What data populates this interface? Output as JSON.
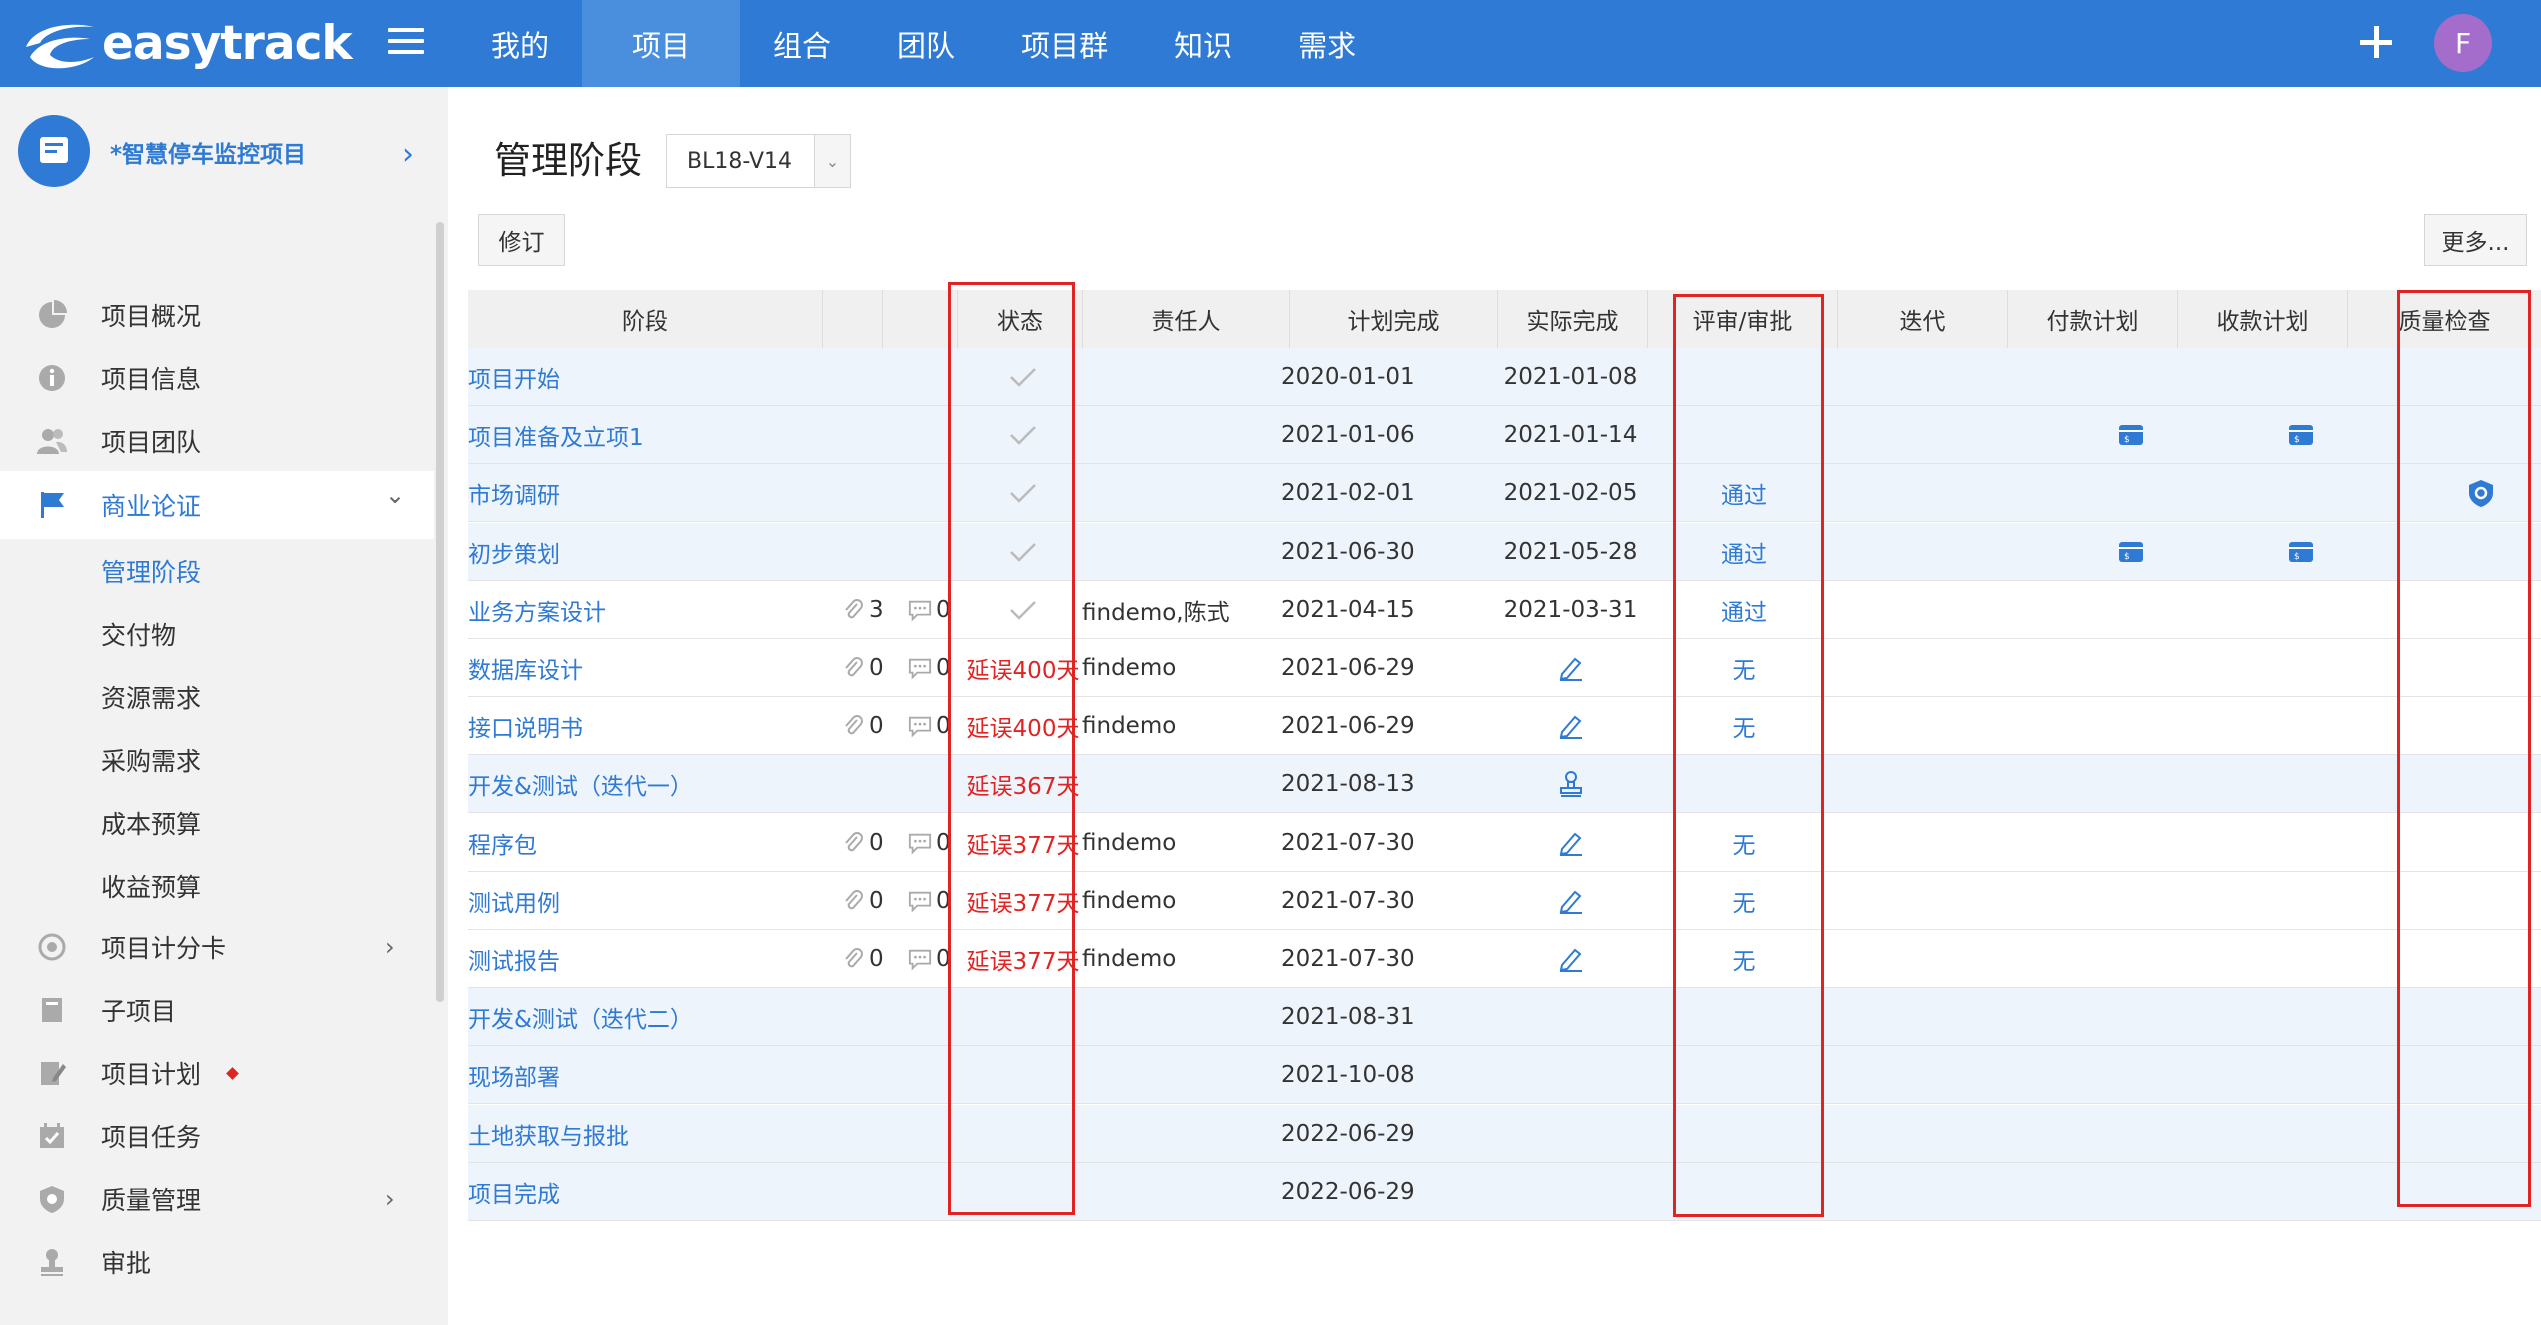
{
  "app": {
    "logo_text": "easytrack"
  },
  "nav": {
    "items": [
      {
        "label": "我的",
        "active": false
      },
      {
        "label": "项目",
        "active": true
      },
      {
        "label": "组合",
        "active": false
      },
      {
        "label": "团队",
        "active": false
      },
      {
        "label": "项目群",
        "active": false
      },
      {
        "label": "知识",
        "active": false
      },
      {
        "label": "需求",
        "active": false
      }
    ],
    "avatar_letter": "F"
  },
  "sidebar": {
    "project_name": "*智慧停车监控项目",
    "items": [
      {
        "label": "项目概况",
        "icon": "pie-chart-icon"
      },
      {
        "label": "项目信息",
        "icon": "info-icon"
      },
      {
        "label": "项目团队",
        "icon": "team-icon"
      },
      {
        "label": "商业论证",
        "icon": "flag-icon",
        "expanded": true
      },
      {
        "label": "管理阶段",
        "sub": true,
        "active": true
      },
      {
        "label": "交付物",
        "sub": true
      },
      {
        "label": "资源需求",
        "sub": true
      },
      {
        "label": "采购需求",
        "sub": true
      },
      {
        "label": "成本预算",
        "sub": true
      },
      {
        "label": "收益预算",
        "sub": true
      },
      {
        "label": "项目计分卡",
        "icon": "target-icon",
        "chevron": true
      },
      {
        "label": "子项目",
        "icon": "book-icon"
      },
      {
        "label": "项目计划",
        "icon": "edit-doc-icon",
        "badge": true
      },
      {
        "label": "项目任务",
        "icon": "calendar-check-icon"
      },
      {
        "label": "质量管理",
        "icon": "shield-icon",
        "chevron": true
      },
      {
        "label": "审批",
        "icon": "stamp-icon"
      }
    ]
  },
  "page": {
    "title": "管理阶段",
    "version": "BL18-V14",
    "revise_label": "修订",
    "more_label": "更多..."
  },
  "table": {
    "headers": {
      "stage": "阶段",
      "status": "状态",
      "owner": "责任人",
      "plan_done": "计划完成",
      "actual_done": "实际完成",
      "review": "评审/审批",
      "iteration": "迭代",
      "payment": "付款计划",
      "receipt": "收款计划",
      "quality": "质量检查"
    },
    "rows": [
      {
        "stage": "项目开始",
        "attach": "",
        "comment": "",
        "status": "done",
        "owner": "",
        "plan": "2020-01-01",
        "actual": "2021-01-08",
        "review": "",
        "pay": false,
        "recv": false,
        "qc": false,
        "shade": true
      },
      {
        "stage": "项目准备及立项1",
        "attach": "",
        "comment": "",
        "status": "done",
        "owner": "",
        "plan": "2021-01-06",
        "actual": "2021-01-14",
        "review": "",
        "pay": true,
        "recv": true,
        "qc": false,
        "shade": true
      },
      {
        "stage": "市场调研",
        "attach": "",
        "comment": "",
        "status": "done",
        "owner": "",
        "plan": "2021-02-01",
        "actual": "2021-02-05",
        "review": "通过",
        "pay": false,
        "recv": false,
        "qc": true,
        "shade": true
      },
      {
        "stage": "初步策划",
        "attach": "",
        "comment": "",
        "status": "done",
        "owner": "",
        "plan": "2021-06-30",
        "actual": "2021-05-28",
        "review": "通过",
        "pay": true,
        "recv": true,
        "qc": false,
        "shade": true
      },
      {
        "stage": "业务方案设计",
        "attach": "3",
        "comment": "0",
        "status": "done",
        "owner": "findemo,陈式",
        "plan": "2021-04-15",
        "actual": "2021-03-31",
        "review": "通过",
        "pay": false,
        "recv": false,
        "qc": false,
        "shade": false
      },
      {
        "stage": "数据库设计",
        "attach": "0",
        "comment": "0",
        "status": "延误400天",
        "owner": "findemo",
        "plan": "2021-06-29",
        "actual": "edit",
        "review": "无",
        "pay": false,
        "recv": false,
        "qc": false,
        "shade": false
      },
      {
        "stage": "接口说明书",
        "attach": "0",
        "comment": "0",
        "status": "延误400天",
        "owner": "findemo",
        "plan": "2021-06-29",
        "actual": "edit",
        "review": "无",
        "pay": false,
        "recv": false,
        "qc": false,
        "shade": false
      },
      {
        "stage": "开发&测试（迭代一）",
        "attach": "",
        "comment": "",
        "status": "延误367天",
        "owner": "",
        "plan": "2021-08-13",
        "actual": "stamp",
        "review": "",
        "pay": false,
        "recv": false,
        "qc": false,
        "shade": true
      },
      {
        "stage": "程序包",
        "attach": "0",
        "comment": "0",
        "status": "延误377天",
        "owner": "findemo",
        "plan": "2021-07-30",
        "actual": "edit",
        "review": "无",
        "pay": false,
        "recv": false,
        "qc": false,
        "shade": false
      },
      {
        "stage": "测试用例",
        "attach": "0",
        "comment": "0",
        "status": "延误377天",
        "owner": "findemo",
        "plan": "2021-07-30",
        "actual": "edit",
        "review": "无",
        "pay": false,
        "recv": false,
        "qc": false,
        "shade": false
      },
      {
        "stage": "测试报告",
        "attach": "0",
        "comment": "0",
        "status": "延误377天",
        "owner": "findemo",
        "plan": "2021-07-30",
        "actual": "edit",
        "review": "无",
        "pay": false,
        "recv": false,
        "qc": false,
        "shade": false
      },
      {
        "stage": "开发&测试（迭代二）",
        "attach": "",
        "comment": "",
        "status": "",
        "owner": "",
        "plan": "2021-08-31",
        "actual": "",
        "review": "",
        "pay": false,
        "recv": false,
        "qc": false,
        "shade": true
      },
      {
        "stage": "现场部署",
        "attach": "",
        "comment": "",
        "status": "",
        "owner": "",
        "plan": "2021-10-08",
        "actual": "",
        "review": "",
        "pay": false,
        "recv": false,
        "qc": false,
        "shade": true
      },
      {
        "stage": "土地获取与报批",
        "attach": "",
        "comment": "",
        "status": "",
        "owner": "",
        "plan": "2022-06-29",
        "actual": "",
        "review": "",
        "pay": false,
        "recv": false,
        "qc": false,
        "shade": true
      },
      {
        "stage": "项目完成",
        "attach": "",
        "comment": "",
        "status": "",
        "owner": "",
        "plan": "2022-06-29",
        "actual": "",
        "review": "",
        "pay": false,
        "recv": false,
        "qc": false,
        "shade": true
      }
    ]
  },
  "colors": {
    "brand": "#2e7ad4",
    "delay": "#e02424",
    "highlight_box": "#e02424"
  }
}
